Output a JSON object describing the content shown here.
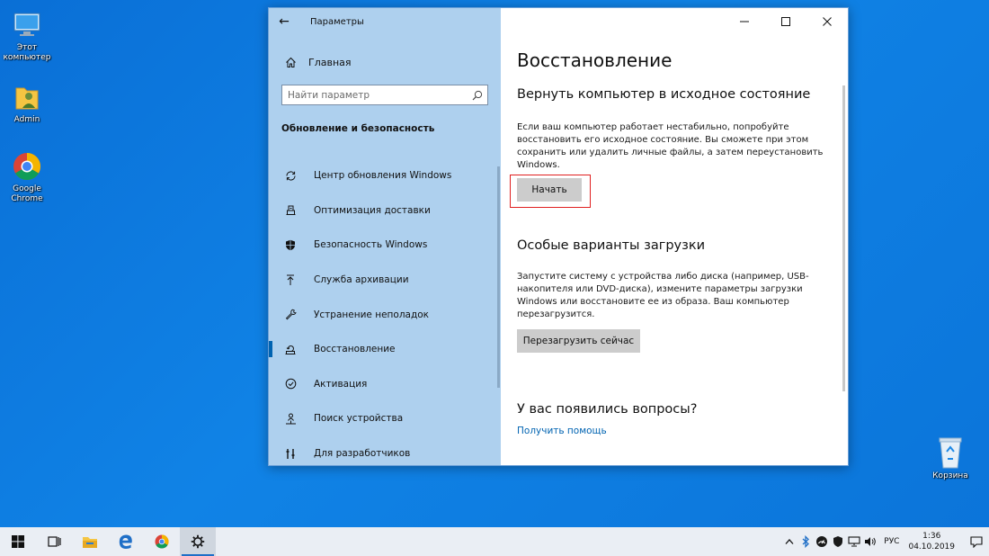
{
  "desktop": {
    "icons": [
      {
        "label": "Этот компьютер",
        "icon": "this-pc-icon"
      },
      {
        "label": "Admin",
        "icon": "user-folder-icon"
      },
      {
        "label": "Google Chrome",
        "icon": "chrome-icon"
      },
      {
        "label": "Корзина",
        "icon": "recycle-bin-icon"
      }
    ]
  },
  "window": {
    "title": "Параметры",
    "controls": [
      "minimize-icon",
      "maximize-icon",
      "close-icon"
    ],
    "sidebar": {
      "home": "Главная",
      "search_placeholder": "Найти параметр",
      "section": "Обновление и безопасность",
      "items": [
        {
          "label": "Центр обновления Windows",
          "icon": "sync-icon"
        },
        {
          "label": "Оптимизация доставки",
          "icon": "delivery-icon"
        },
        {
          "label": "Безопасность Windows",
          "icon": "shield-icon"
        },
        {
          "label": "Служба архивации",
          "icon": "backup-arrow-icon"
        },
        {
          "label": "Устранение неполадок",
          "icon": "wrench-icon"
        },
        {
          "label": "Восстановление",
          "icon": "recovery-icon",
          "active": true
        },
        {
          "label": "Активация",
          "icon": "check-circle-icon"
        },
        {
          "label": "Поиск устройства",
          "icon": "person-location-icon"
        },
        {
          "label": "Для разработчиков",
          "icon": "developer-tools-icon"
        }
      ]
    },
    "content": {
      "title": "Восстановление",
      "reset": {
        "heading": "Вернуть компьютер в исходное состояние",
        "text": "Если ваш компьютер работает нестабильно, попробуйте восстановить его исходное состояние. Вы сможете при этом сохранить или удалить личные файлы, а затем переустановить Windows.",
        "button": "Начать"
      },
      "advanced": {
        "heading": "Особые варианты загрузки",
        "text": "Запустите систему с устройства либо диска (например, USB-накопителя или DVD-диска), измените параметры загрузки Windows или восстановите ее из образа. Ваш компьютер перезагрузится.",
        "button": "Перезагрузить сейчас"
      },
      "questions": {
        "heading": "У вас появились вопросы?",
        "link": "Получить помощь"
      }
    }
  },
  "taskbar": {
    "language": "РУС",
    "time": "1:36",
    "date": "04.10.2019"
  },
  "colors": {
    "desktop": "#0b74d9",
    "sidebar": "#aed0ee",
    "accent": "#0063b1",
    "highlight": "#e02020"
  }
}
